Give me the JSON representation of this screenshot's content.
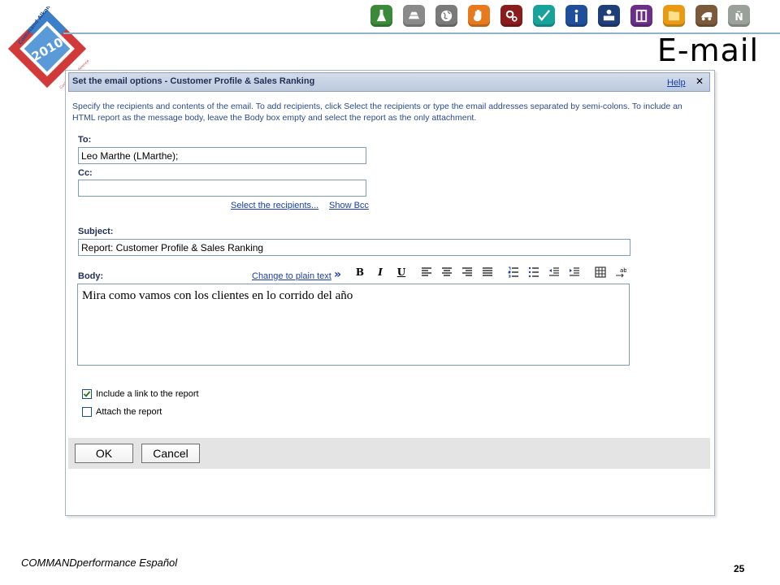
{
  "slide": {
    "title": "E-mail",
    "footer": "COMMANDperformance Español",
    "page_number": "25",
    "logo": {
      "line1": "Command Alkon",
      "year": "2010",
      "line2": "Customer Conference"
    }
  },
  "top_icons": [
    {
      "name": "flask-icon",
      "color": "#3a8a3a"
    },
    {
      "name": "stack-icon",
      "color": "#8a8a8a"
    },
    {
      "name": "globe-icon",
      "color": "#7a7a7a"
    },
    {
      "name": "hand-icon",
      "color": "#e87a1e"
    },
    {
      "name": "gears-icon",
      "color": "#8a1c1c"
    },
    {
      "name": "check-icon",
      "color": "#18a39a"
    },
    {
      "name": "info-icon",
      "color": "#1f4e9a"
    },
    {
      "name": "person-desk-icon",
      "color": "#1f3f7a"
    },
    {
      "name": "door-icon",
      "color": "#6b2f8a"
    },
    {
      "name": "folder-icon",
      "color": "#e89a12"
    },
    {
      "name": "truck-icon",
      "color": "#7a5a3a"
    },
    {
      "name": "letter-n-icon",
      "color": "#9aa09a"
    }
  ],
  "dialog": {
    "title": "Set the email options - Customer Profile & Sales Ranking",
    "help_label": "Help",
    "close_symbol": "✕",
    "instructions": "Specify the recipients and contents of the email. To add recipients, click Select the recipients or type the email addresses separated by semi-colons. To include an HTML report as the message body, leave the Body box empty and select the report as the only attachment.",
    "to": {
      "label": "To:",
      "value": "Leo Marthe (LMarthe);"
    },
    "cc": {
      "label": "Cc:",
      "value": ""
    },
    "select_recipients_label": "Select the recipients...",
    "show_bcc_label": "Show Bcc",
    "subject": {
      "label": "Subject:",
      "value": "Report: Customer Profile & Sales Ranking"
    },
    "body": {
      "label": "Body:",
      "change_plain_label": "Change to plain text",
      "change_plain_arrow": "»",
      "text": "Mira como vamos con los clientes en lo corrido del año"
    },
    "toolbar": {
      "bold": "B",
      "italic": "I",
      "underline": "U",
      "spell_label": "ab"
    },
    "options": [
      {
        "label": "Include a link to the report",
        "checked": true
      },
      {
        "label": "Attach the report",
        "checked": false
      }
    ],
    "ok_label": "OK",
    "cancel_label": "Cancel"
  }
}
